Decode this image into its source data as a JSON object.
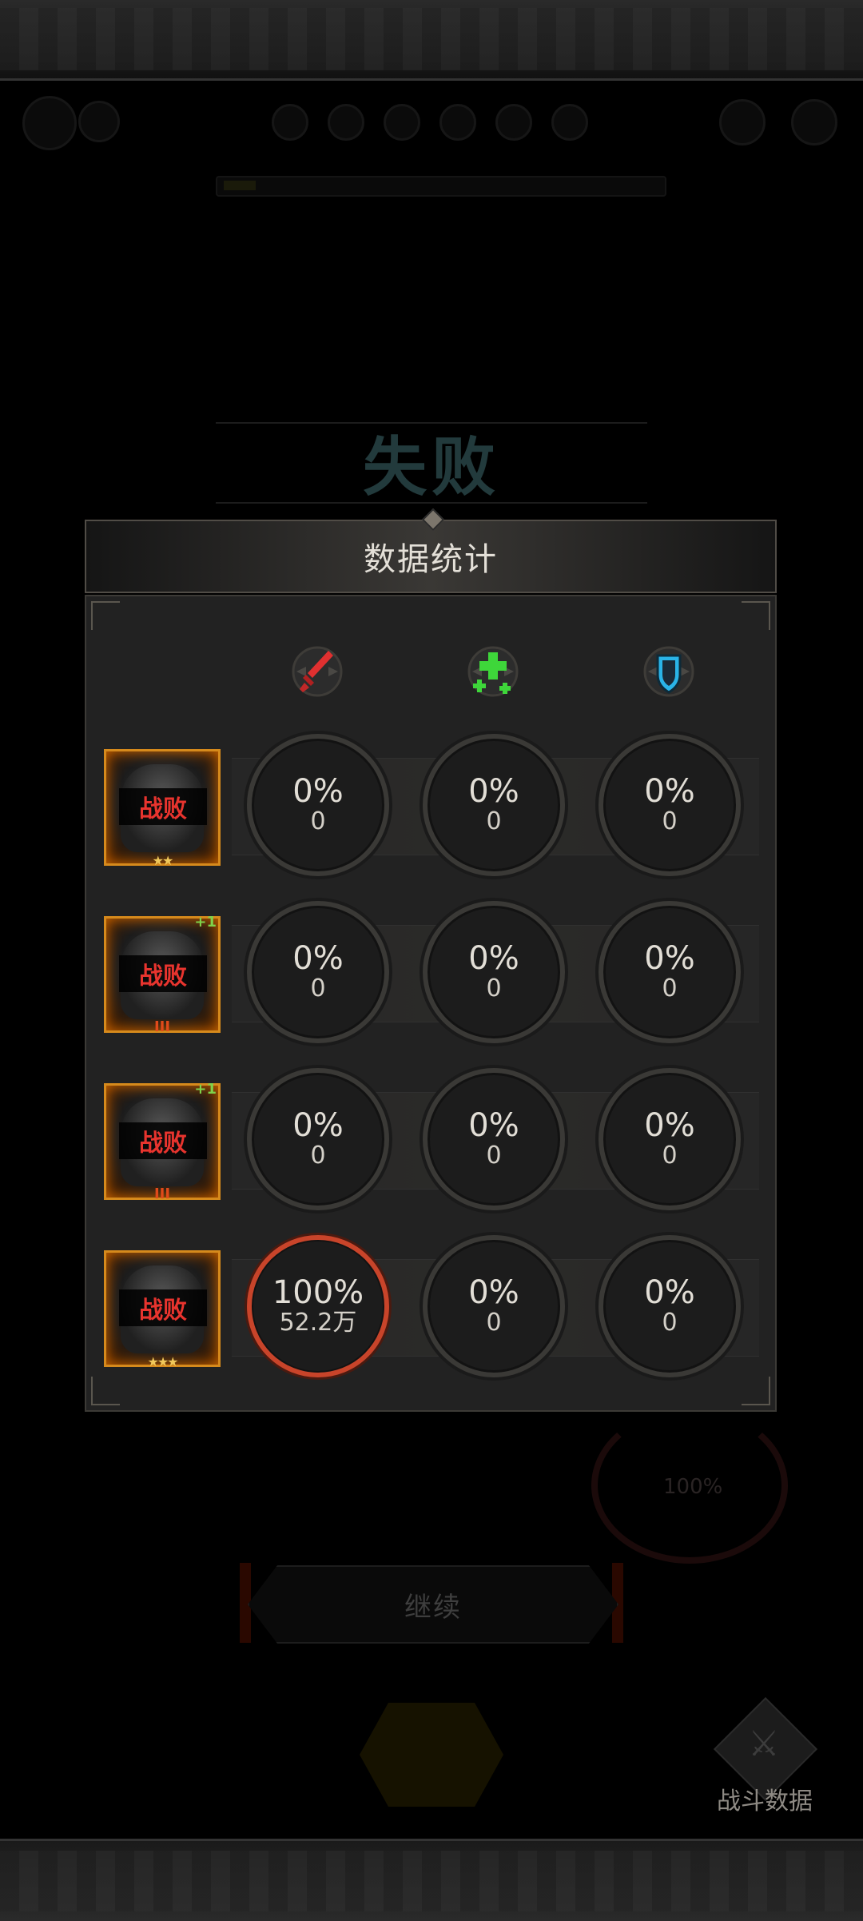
{
  "result": {
    "title": "失败"
  },
  "panel": {
    "title": "数据统计",
    "columns": [
      {
        "name": "damage",
        "icon": "red-sword-icon"
      },
      {
        "name": "heal",
        "icon": "green-plus-icon"
      },
      {
        "name": "tank",
        "icon": "blue-shield-icon"
      }
    ],
    "rows": [
      {
        "status": "战败",
        "stars": "★★",
        "badge": "",
        "cells": [
          {
            "pct": "0%",
            "val": "0"
          },
          {
            "pct": "0%",
            "val": "0"
          },
          {
            "pct": "0%",
            "val": "0"
          }
        ]
      },
      {
        "status": "战败",
        "stars": "",
        "badge": "+1",
        "roman": "III",
        "cells": [
          {
            "pct": "0%",
            "val": "0"
          },
          {
            "pct": "0%",
            "val": "0"
          },
          {
            "pct": "0%",
            "val": "0"
          }
        ]
      },
      {
        "status": "战败",
        "stars": "",
        "badge": "+1",
        "roman": "III",
        "cells": [
          {
            "pct": "0%",
            "val": "0"
          },
          {
            "pct": "0%",
            "val": "0"
          },
          {
            "pct": "0%",
            "val": "0"
          }
        ]
      },
      {
        "status": "战败",
        "stars": "★★★",
        "badge": "",
        "cells": [
          {
            "pct": "100%",
            "val": "52.2万"
          },
          {
            "pct": "0%",
            "val": "0"
          },
          {
            "pct": "0%",
            "val": "0"
          }
        ]
      }
    ]
  },
  "footer": {
    "continue_label": "继续",
    "stats_label": "战斗数据",
    "dim_ring_text": "100%"
  },
  "colors": {
    "defeat_text": "#e8342e",
    "active_ring": "#c8442a",
    "portrait_frame": "#d68a1c"
  }
}
